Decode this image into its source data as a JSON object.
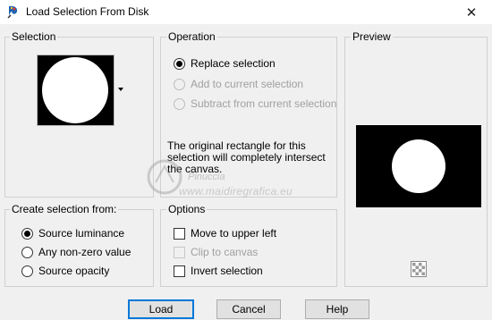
{
  "window": {
    "title": "Load Selection From Disk",
    "close_symbol": "✕"
  },
  "selection_group": {
    "label": "Selection"
  },
  "operation_group": {
    "label": "Operation",
    "options": [
      {
        "label": "Replace selection",
        "checked": true,
        "enabled": true
      },
      {
        "label": "Add to current selection",
        "checked": false,
        "enabled": false
      },
      {
        "label": "Subtract from current selection",
        "checked": false,
        "enabled": false
      }
    ],
    "info_lines": [
      "The original rectangle for this",
      "selection will completely intersect",
      "the canvas."
    ]
  },
  "preview_group": {
    "label": "Preview"
  },
  "create_group": {
    "label": "Create selection from:",
    "options": [
      {
        "label": "Source luminance",
        "checked": true
      },
      {
        "label": "Any non-zero value",
        "checked": false
      },
      {
        "label": "Source opacity",
        "checked": false
      }
    ]
  },
  "options_group": {
    "label": "Options",
    "items": [
      {
        "label": "Move to upper left",
        "checked": false,
        "enabled": true
      },
      {
        "label": "Clip to canvas",
        "checked": false,
        "enabled": false
      },
      {
        "label": "Invert selection",
        "checked": false,
        "enabled": true
      }
    ]
  },
  "watermark": {
    "line1": "Pinuccia",
    "line2": "www.maidiregrafica.eu"
  },
  "buttons": {
    "load": "Load",
    "cancel": "Cancel",
    "help": "Help"
  },
  "colors": {
    "accent": "#0078d7",
    "dialog_bg": "#f0f0f0",
    "preview_bg": "#000000",
    "selection_shape": "#ffffff"
  },
  "icons": {
    "app": "paint-app-icon",
    "close": "close-icon",
    "dropdown": "chevron-down-icon",
    "checker": "transparency-checker-icon"
  }
}
